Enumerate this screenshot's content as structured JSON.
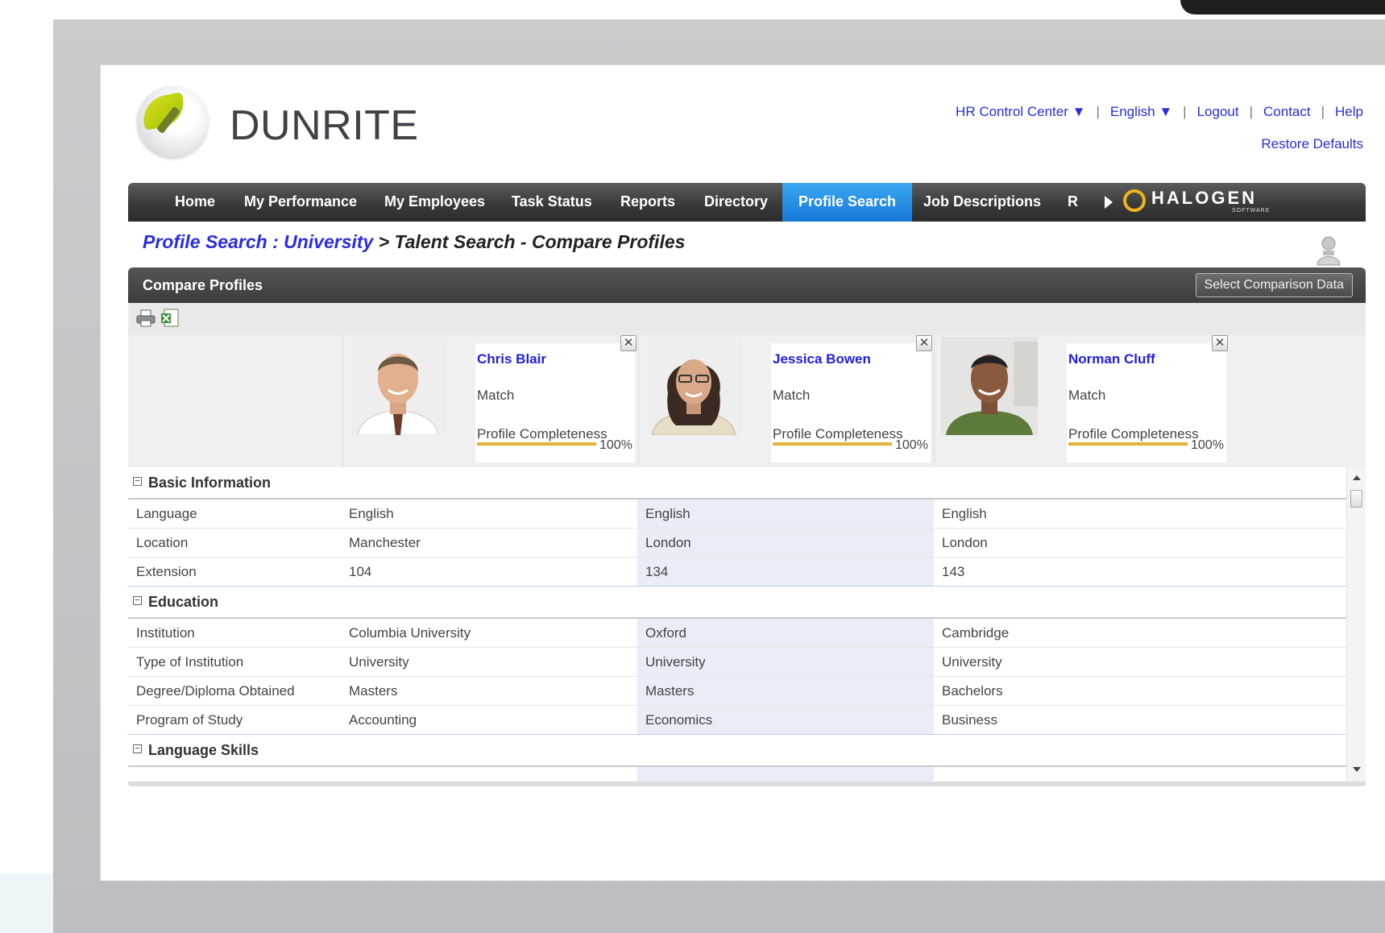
{
  "header": {
    "logo_text": "DUNRITE",
    "links": [
      "HR Control Center ▼",
      "English ▼",
      "Logout",
      "Contact",
      "Help"
    ],
    "separator": "|",
    "restore": "Restore Defaults"
  },
  "nav": {
    "items": [
      "Home",
      "My Performance",
      "My Employees",
      "Task Status",
      "Reports",
      "Directory",
      "Profile Search",
      "Job Descriptions",
      "R"
    ],
    "active": "Profile Search",
    "brand": "HALOGEN",
    "brand_sub": "SOFTWARE"
  },
  "breadcrumb": {
    "link": "Profile Search : University",
    "rest": " > Talent Search - Compare Profiles"
  },
  "panel": {
    "title": "Compare Profiles",
    "select_button": "Select Comparison Data"
  },
  "profiles": [
    {
      "name": "Chris Blair",
      "match_label": "Match",
      "completeness_label": "Profile Completeness",
      "completeness": "100%",
      "completeness_value": 1.0
    },
    {
      "name": "Jessica Bowen",
      "match_label": "Match",
      "completeness_label": "Profile Completeness",
      "completeness": "100%",
      "completeness_value": 1.0
    },
    {
      "name": "Norman Cluff",
      "match_label": "Match",
      "completeness_label": "Profile Completeness",
      "completeness": "100%",
      "completeness_value": 1.0
    }
  ],
  "sections": [
    {
      "title": "Basic Information",
      "rows": [
        {
          "label": "Language",
          "values": [
            "English",
            "English",
            "English"
          ]
        },
        {
          "label": "Location",
          "values": [
            "Manchester",
            "London",
            "London"
          ]
        },
        {
          "label": "Extension",
          "values": [
            "104",
            "134",
            "143"
          ]
        }
      ]
    },
    {
      "title": "Education",
      "rows": [
        {
          "label": "Institution",
          "values": [
            "Columbia University",
            "Oxford",
            "Cambridge"
          ]
        },
        {
          "label": "Type of Institution",
          "values": [
            "University",
            "University",
            "University"
          ]
        },
        {
          "label": "Degree/Diploma Obtained",
          "values": [
            "Masters",
            "Masters",
            "Bachelors"
          ]
        },
        {
          "label": "Program of Study",
          "values": [
            "Accounting",
            "Economics",
            "Business"
          ]
        }
      ]
    },
    {
      "title": "Language Skills",
      "rows": []
    }
  ],
  "colors": {
    "link": "#2530d8",
    "nav_active": "#1e88e5",
    "accent_bar": "#e1b23c",
    "highlight_col": "#e9edf8"
  }
}
